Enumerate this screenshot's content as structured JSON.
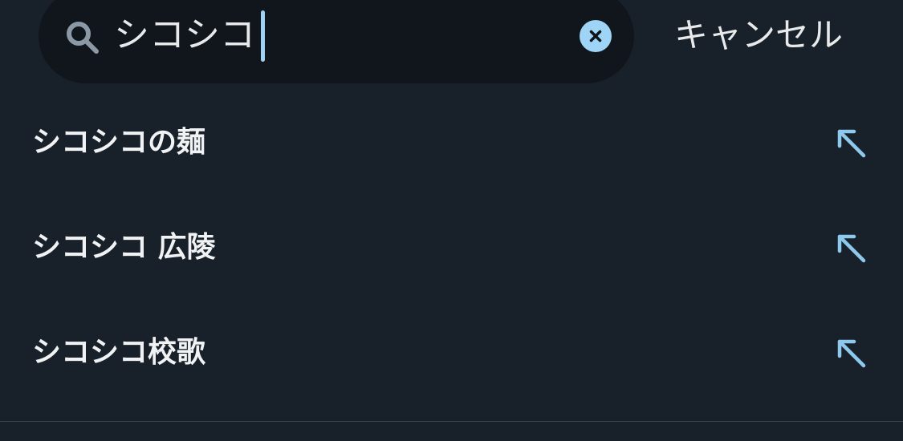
{
  "search": {
    "query": "シコシコ",
    "icon": "search-icon",
    "clear_icon": "close-icon"
  },
  "cancel_label": "キャンセル",
  "suggestions": [
    {
      "label": "シコシコの麺",
      "icon": "arrow-up-left-icon"
    },
    {
      "label": "シコシコ 広陵",
      "icon": "arrow-up-left-icon"
    },
    {
      "label": "シコシコ校歌",
      "icon": "arrow-up-left-icon"
    }
  ],
  "colors": {
    "background": "#18202a",
    "search_field": "#11161d",
    "accent": "#9ed4f6",
    "text": "#e7e9ea"
  }
}
